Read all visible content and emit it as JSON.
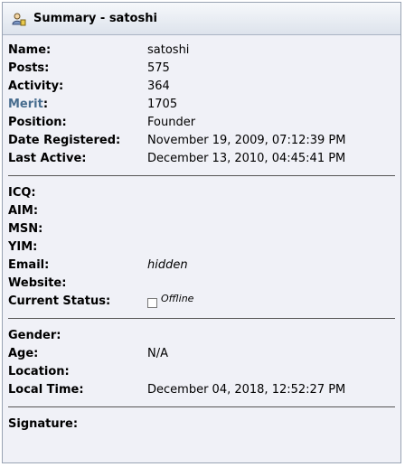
{
  "header": {
    "title": "Summary - satoshi",
    "icon": "user-profile-icon"
  },
  "summary": {
    "name_label": "Name:",
    "name_value": "satoshi",
    "posts_label": "Posts:",
    "posts_value": "575",
    "activity_label": "Activity:",
    "activity_value": "364",
    "merit_label": "Merit",
    "merit_colon": ":",
    "merit_value": "1705",
    "position_label": "Position:",
    "position_value": "Founder",
    "registered_label": "Date Registered:",
    "registered_value": "November 19, 2009, 07:12:39 PM",
    "last_active_label": "Last Active:",
    "last_active_value": "December 13, 2010, 04:45:41 PM"
  },
  "contact": {
    "icq_label": "ICQ:",
    "aim_label": "AIM:",
    "msn_label": "MSN:",
    "yim_label": "YIM:",
    "email_label": "Email:",
    "email_value": "hidden",
    "website_label": "Website:",
    "status_label": "Current Status:",
    "status_value": "Offline"
  },
  "personal": {
    "gender_label": "Gender:",
    "age_label": "Age:",
    "age_value": "N/A",
    "location_label": "Location:",
    "local_time_label": "Local Time:",
    "local_time_value": "December 04, 2018, 12:52:27 PM"
  },
  "signature": {
    "label": "Signature:"
  },
  "colors": {
    "merit_link": "#476c8e",
    "panel_bg": "#f0f1f7",
    "header_border": "#aab4c4"
  }
}
